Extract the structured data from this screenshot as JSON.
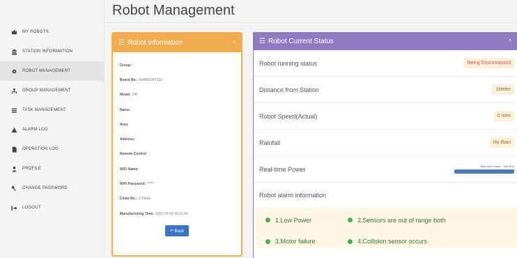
{
  "page": {
    "title": "Robot Management"
  },
  "sidebar": {
    "items": [
      {
        "label": "MY ROBOTS",
        "icon": "robot-icon"
      },
      {
        "label": "STATION INFORMATION",
        "icon": "station-icon"
      },
      {
        "label": "ROBOT MANAGEMENT",
        "icon": "gear-icon",
        "active": true
      },
      {
        "label": "GROUP MANAGEMENT",
        "icon": "group-icon"
      },
      {
        "label": "TASK MANAGEMENT",
        "icon": "list-icon"
      },
      {
        "label": "ALARM LOG",
        "icon": "warning-icon"
      },
      {
        "label": "OPERATION LOG",
        "icon": "document-icon"
      },
      {
        "label": "PROFILE",
        "icon": "user-icon"
      },
      {
        "label": "CHANGE PASSWORD",
        "icon": "key-icon"
      },
      {
        "label": "LOGOUT",
        "icon": "logout-icon"
      }
    ]
  },
  "info": {
    "title": "Robot Information",
    "rows": [
      {
        "label": "Group:",
        "value": ""
      },
      {
        "label": "Board No.:",
        "value": "43484304T520"
      },
      {
        "label": "Model:",
        "value": "HR"
      },
      {
        "label": "Name:",
        "value": ""
      },
      {
        "label": "Area:",
        "value": ""
      },
      {
        "label": "Address:",
        "value": ""
      },
      {
        "label": "Remote Control:",
        "value": ""
      },
      {
        "label": "WiFi Name:",
        "value": ""
      },
      {
        "label": "WiFi Password:",
        "value": "*****"
      },
      {
        "label": "Clean No.:",
        "value": "3 Times"
      },
      {
        "label": "Manufacturing Time:",
        "value": "2022-03-04 16:21:54"
      }
    ],
    "back_label": "Back"
  },
  "status": {
    "title": "Robot Current Status",
    "running_label": "Robot running status",
    "running_value": "Being Disconnected",
    "distance_label": "Distance from Station",
    "distance_value": "1Meter",
    "speed_label": "Robot Speed(Actual)",
    "speed_value": "0 m/m",
    "rainfall_label": "Rainfall",
    "rainfall_value": "No Rain",
    "power_label": "Real-time Power",
    "power_caption": "Real-time Power : 100.00%",
    "power_percent": 100,
    "alarm_label": "Robot alarm information",
    "alarms": [
      "1.Low Power",
      "2.Sensors are out of range both",
      "3.Motor failure",
      "4.Collision sensor occurs"
    ]
  },
  "colors": {
    "info_accent": "#f0ad4e",
    "status_accent": "#8e7cc3",
    "primary_button": "#3a73c4",
    "alarm_green": "#4cae4c"
  }
}
